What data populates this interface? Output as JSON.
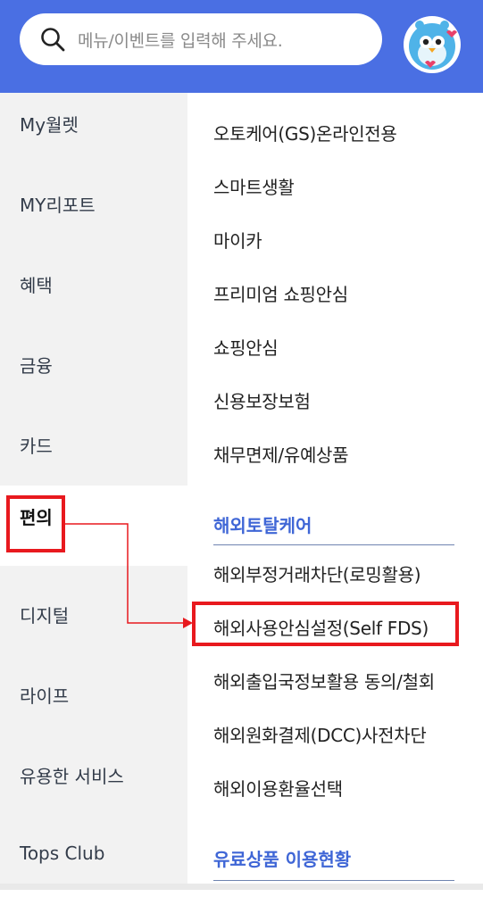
{
  "search": {
    "placeholder": "메뉴/이벤트를 입력해 주세요."
  },
  "sidebar": {
    "items": [
      {
        "label": "My월렛"
      },
      {
        "label": "MY리포트"
      },
      {
        "label": "혜택"
      },
      {
        "label": "금융"
      },
      {
        "label": "카드"
      },
      {
        "label": "편의",
        "active": true
      },
      {
        "label": "디지털"
      },
      {
        "label": "라이프"
      },
      {
        "label": "유용한 서비스"
      },
      {
        "label": "Tops Club"
      }
    ]
  },
  "main": {
    "items": [
      "오토케어(GS)온라인전용",
      "스마트생활",
      "마이카",
      "프리미엄 쇼핑안심",
      "쇼핑안심",
      "신용보장보험",
      "채무면제/유예상품"
    ],
    "section1": {
      "title": "해외토탈케어",
      "items": [
        "해외부정거래차단(로밍활용)",
        "해외사용안심설정(Self FDS)",
        "해외출입국정보활용 동의/철회",
        "해외원화결제(DCC)사전차단",
        "해외이용환율선택"
      ]
    },
    "section2": {
      "title": "유료상품 이용현황"
    }
  },
  "colors": {
    "header": "#4a6fe3",
    "accent": "#3f66d6",
    "highlight": "#e8191e",
    "sidebar_bg": "#f2f2f2"
  }
}
